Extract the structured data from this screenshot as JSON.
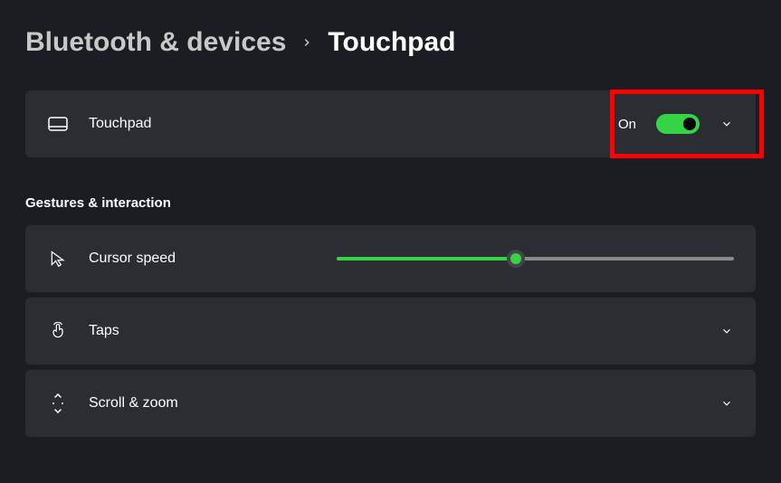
{
  "breadcrumb": {
    "parent": "Bluetooth & devices",
    "current": "Touchpad"
  },
  "touchpad": {
    "label": "Touchpad",
    "state_label": "On",
    "state_on": true,
    "highlighted": true
  },
  "section_heading": "Gestures & interaction",
  "cursor_speed": {
    "label": "Cursor speed",
    "value_percent": 45
  },
  "taps": {
    "label": "Taps"
  },
  "scroll_zoom": {
    "label": "Scroll & zoom"
  },
  "colors": {
    "accent_green": "#35d447",
    "highlight_red": "#ff0000",
    "bg": "#1a1d21",
    "card_bg": "#2a2d32"
  }
}
